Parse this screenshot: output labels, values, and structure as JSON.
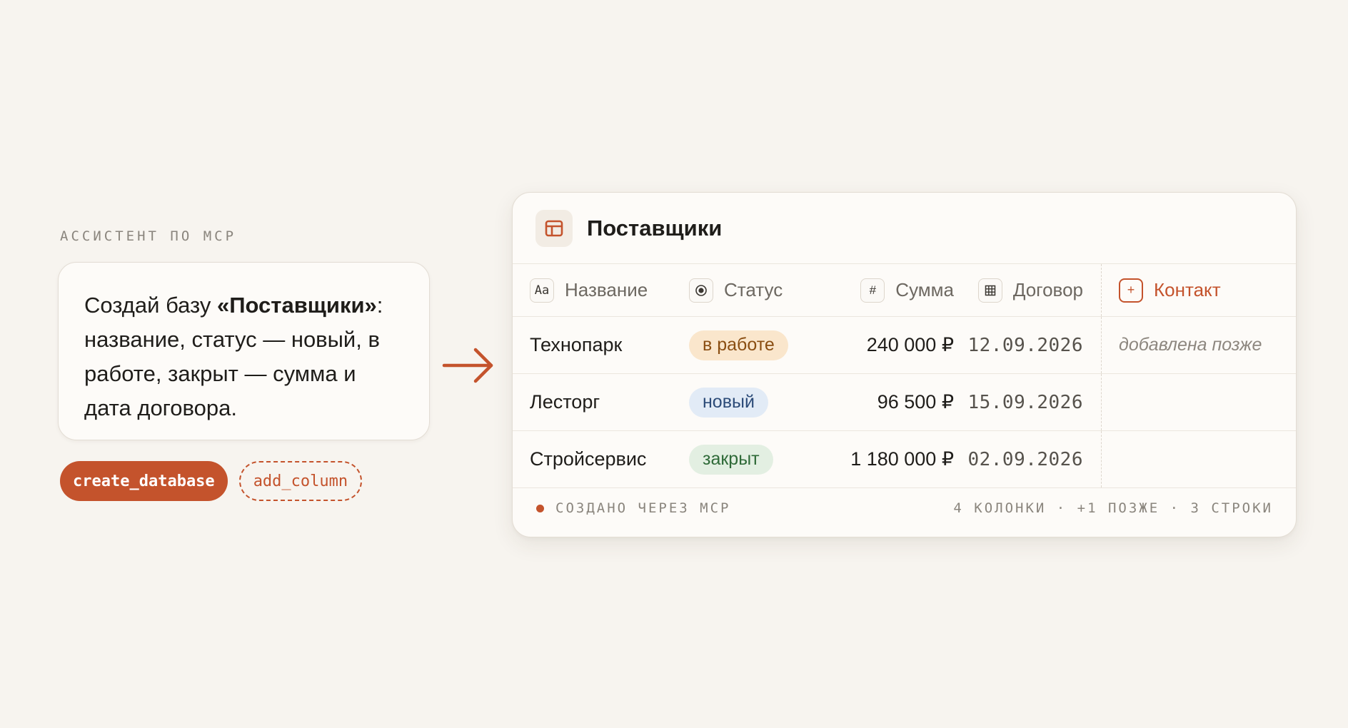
{
  "assistant": {
    "label": "АССИСТЕНТ ПО MCP",
    "message_prefix": "Создай базу ",
    "message_bold": "«Поставщики»",
    "message_suffix": ": название, статус — новый, в работе, закрыт — сумма и дата договора."
  },
  "tools": [
    {
      "label": "create_database",
      "style": "solid"
    },
    {
      "label": "add_column",
      "style": "dashed"
    }
  ],
  "database": {
    "title": "Поставщики",
    "icon": "table-icon",
    "columns": [
      {
        "label": "Название",
        "icon": "Aa",
        "icon_name": "text-type-icon"
      },
      {
        "label": "Статус",
        "icon": "◉",
        "icon_name": "status-radio-icon"
      },
      {
        "label": "Сумма",
        "icon": "#",
        "icon_name": "number-hash-icon"
      },
      {
        "label": "Договор",
        "icon": "▦",
        "icon_name": "calendar-icon"
      },
      {
        "label": "Контакт",
        "icon": "+",
        "icon_name": "add-column-icon"
      }
    ],
    "rows": [
      {
        "name": "Технопарк",
        "status": "в работе",
        "status_kind": "work",
        "sum": "240 000 ₽",
        "date": "12.09.2026",
        "contact": "добавлена позже"
      },
      {
        "name": "Лесторг",
        "status": "новый",
        "status_kind": "new",
        "sum": "96 500 ₽",
        "date": "15.09.2026",
        "contact": ""
      },
      {
        "name": "Стройсервис",
        "status": "закрыт",
        "status_kind": "done",
        "sum": "1 180 000 ₽",
        "date": "02.09.2026",
        "contact": ""
      }
    ],
    "footer": {
      "left": "СОЗДАНО ЧЕРЕЗ MCP",
      "right": "4 КОЛОНКИ · +1 ПОЗЖЕ · 3 СТРОКИ"
    }
  },
  "colors": {
    "accent": "#c4532c",
    "background": "#f7f4ef",
    "card": "#fdfbf8"
  }
}
